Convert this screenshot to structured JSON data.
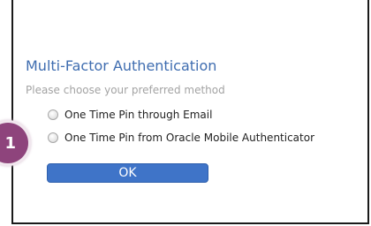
{
  "dialog": {
    "title": "Multi-Factor Authentication",
    "subtitle": "Please choose your preferred method",
    "options": [
      {
        "label": "One Time Pin through Email",
        "selected": false
      },
      {
        "label": "One Time Pin from Oracle Mobile Authenticator",
        "selected": false
      }
    ],
    "ok_label": "OK"
  },
  "annotation": {
    "step_number": "1"
  },
  "colors": {
    "title": "#3f6db0",
    "subtitle": "#a3a3a3",
    "button": "#3f74c8",
    "badge": "#8e447c"
  }
}
